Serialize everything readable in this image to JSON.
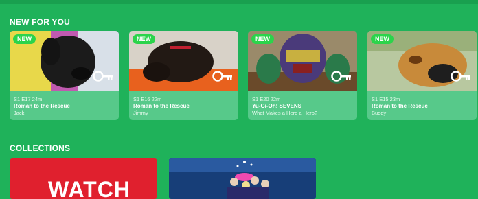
{
  "sections": {
    "new_for_you": "NEW FOR YOU",
    "collections": "COLLECTIONS"
  },
  "cards": [
    {
      "badge": "NEW",
      "episode": "S1 E17 24m",
      "title": "Roman to the Rescue",
      "subtitle": "Jack",
      "icon": "key-icon"
    },
    {
      "badge": "NEW",
      "episode": "S1 E16 22m",
      "title": "Roman to the Rescue",
      "subtitle": "Jimmy",
      "icon": "key-icon"
    },
    {
      "badge": "NEW",
      "episode": "S1 E20 22m",
      "title": "Yu-Gi-Oh! SEVENS",
      "subtitle": "What Makes a Hero a Hero?",
      "icon": "key-icon"
    },
    {
      "badge": "NEW",
      "episode": "S1 E15 23m",
      "title": "Roman to the Rescue",
      "subtitle": "Buddy",
      "icon": "key-icon"
    }
  ],
  "collections": [
    {
      "label": "WATCH"
    },
    {
      "label": ""
    }
  ],
  "colors": {
    "background": "#1fb25a",
    "card": "#57c98a",
    "badge": "#2bd44b",
    "collection_red": "#e0202e",
    "collection_blue": "#173e78"
  }
}
